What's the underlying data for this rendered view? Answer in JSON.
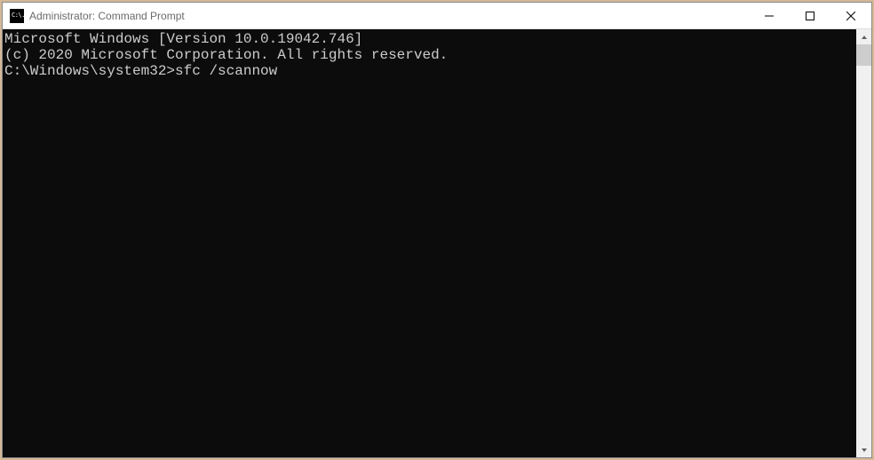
{
  "titlebar": {
    "icon_text": "C:\\.",
    "title": "Administrator: Command Prompt"
  },
  "terminal": {
    "lines": [
      "Microsoft Windows [Version 10.0.19042.746]",
      "(c) 2020 Microsoft Corporation. All rights reserved.",
      "",
      "C:\\Windows\\system32>sfc /scannow"
    ],
    "prompt": "C:\\Windows\\system32>",
    "command": "sfc /scannow"
  }
}
